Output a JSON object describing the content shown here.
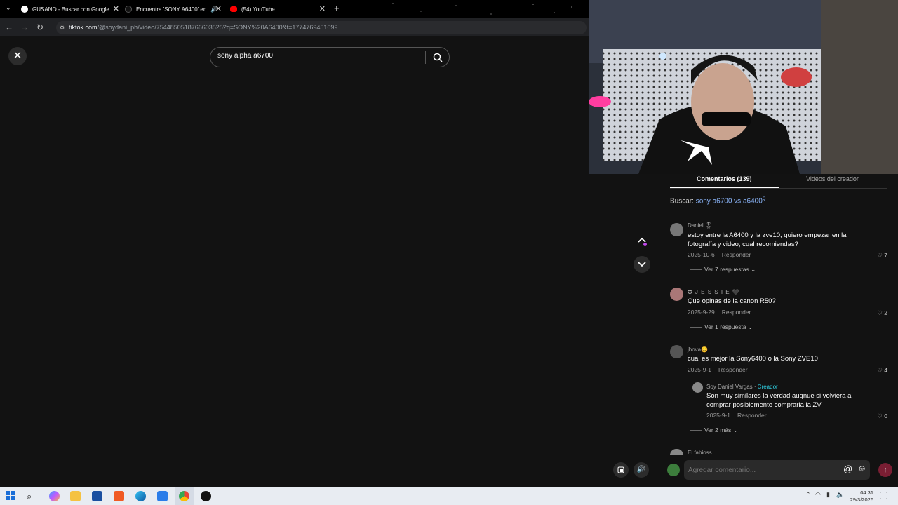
{
  "browser": {
    "tabs": [
      {
        "title": "GUSANO - Buscar con Google",
        "color": "#ffffff"
      },
      {
        "title": "Encuentra 'SONY A6400' en",
        "color": "#111111"
      },
      {
        "title": "(54) YouTube",
        "color": "#ff0000"
      }
    ],
    "url_host": "tiktok.com",
    "url_path": "/@soydani_ph/video/7544850518766603525?q=SONY%20A6400&t=1774769451699"
  },
  "search": {
    "value": "sony alpha a6700"
  },
  "panel": {
    "tab_comments": "Comentarios (139)",
    "tab_creator_videos": "Videos del creador",
    "buscar_label": "Buscar:",
    "buscar_query": "sony a6700 vs a6400"
  },
  "comments": [
    {
      "name": "Daniel 🎖",
      "text": "estoy entre la A6400 y la zve10, quiero empezar en la fotografía y video, cual recomiendas?",
      "date": "2025-10-6",
      "reply": "Responder",
      "likes": "7",
      "more": "Ver 7 respuestas"
    },
    {
      "name": "✪ J E S S I E 🖤",
      "text": "Que opinas de la canon R50?",
      "date": "2025-9-29",
      "reply": "Responder",
      "likes": "2",
      "more": "Ver 1 respuesta"
    },
    {
      "name": "jhova😊",
      "text": "cual es mejor la Sony6400 o la Sony ZVE10",
      "date": "2025-9-1",
      "reply": "Responder",
      "likes": "4",
      "more": "Ver 2 más"
    }
  ],
  "creator_reply": {
    "name": "Soy Daniel Vargas",
    "badge": "Creador",
    "text": "Son muy similares la verdad auqnue si volviera a comprar posiblemente compraria la ZV",
    "date": "2025-9-1",
    "reply": "Responder",
    "likes": "0"
  },
  "next_commenter": "El fabioss",
  "footer": {
    "placeholder": "Agregar comentario..."
  },
  "taskbar": {
    "time": "04:31",
    "date": "29/3/2026"
  },
  "colors": {
    "accent": "#fe2c55",
    "link": "#8ab4f8",
    "creator": "#2fd4e8"
  }
}
